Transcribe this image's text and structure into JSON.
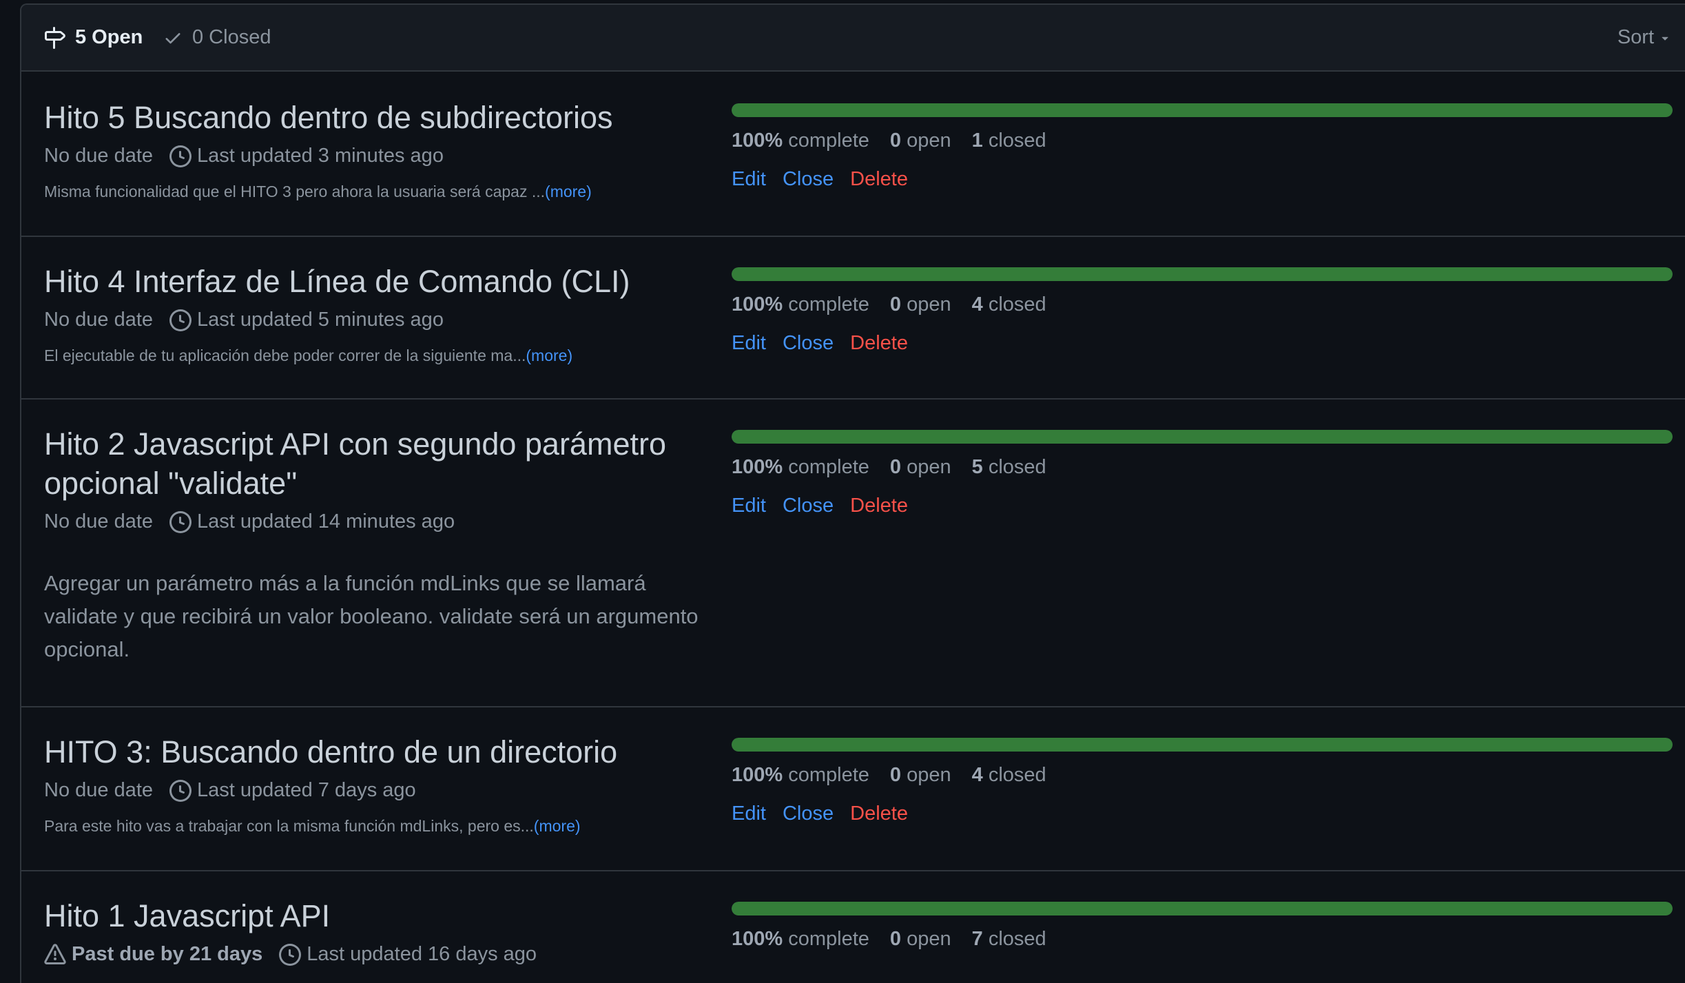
{
  "header": {
    "open_label": "5 Open",
    "closed_label": "0 Closed",
    "sort_label": "Sort"
  },
  "milestones": [
    {
      "title": "Hito 5 Buscando dentro de subdirectorios",
      "due": "No due date",
      "updated": "Last updated 3 minutes ago",
      "description": "Misma funcionalidad que el HITO 3 pero ahora la usuaria será capaz ...",
      "more": "(more)",
      "progress_pct": 100,
      "complete_pct": "100%",
      "complete_word": "complete",
      "open_count": "0",
      "open_word": "open",
      "closed_count": "1",
      "closed_word": "closed",
      "edit": "Edit",
      "close": "Close",
      "delete": "Delete"
    },
    {
      "title": "Hito 4 Interfaz de Línea de Comando (CLI)",
      "due": "No due date",
      "updated": "Last updated 5 minutes ago",
      "description": "El ejecutable de tu aplicación debe poder correr de la siguiente ma...",
      "more": "(more)",
      "progress_pct": 100,
      "complete_pct": "100%",
      "complete_word": "complete",
      "open_count": "0",
      "open_word": "open",
      "closed_count": "4",
      "closed_word": "closed",
      "edit": "Edit",
      "close": "Close",
      "delete": "Delete"
    },
    {
      "title": "Hito 2 Javascript API con segundo parámetro opcional \"validate\"",
      "due": "No due date",
      "updated": "Last updated 14 minutes ago",
      "description": "Agregar un parámetro más a la función mdLinks que se llamará validate y que recibirá un valor booleano. validate será un argumento opcional.",
      "progress_pct": 100,
      "complete_pct": "100%",
      "complete_word": "complete",
      "open_count": "0",
      "open_word": "open",
      "closed_count": "5",
      "closed_word": "closed",
      "edit": "Edit",
      "close": "Close",
      "delete": "Delete"
    },
    {
      "title": "HITO 3: Buscando dentro de un directorio",
      "due": "No due date",
      "updated": "Last updated 7 days ago",
      "description": "Para este hito vas a trabajar con la misma función mdLinks, pero es...",
      "more": "(more)",
      "progress_pct": 100,
      "complete_pct": "100%",
      "complete_word": "complete",
      "open_count": "0",
      "open_word": "open",
      "closed_count": "4",
      "closed_word": "closed",
      "edit": "Edit",
      "close": "Close",
      "delete": "Delete"
    },
    {
      "title": "Hito 1 Javascript API",
      "due": "Past due by 21 days",
      "updated": "Last updated 16 days ago",
      "progress_pct": 100,
      "complete_pct": "100%",
      "complete_word": "complete",
      "open_count": "0",
      "open_word": "open",
      "closed_count": "7",
      "closed_word": "closed"
    }
  ]
}
